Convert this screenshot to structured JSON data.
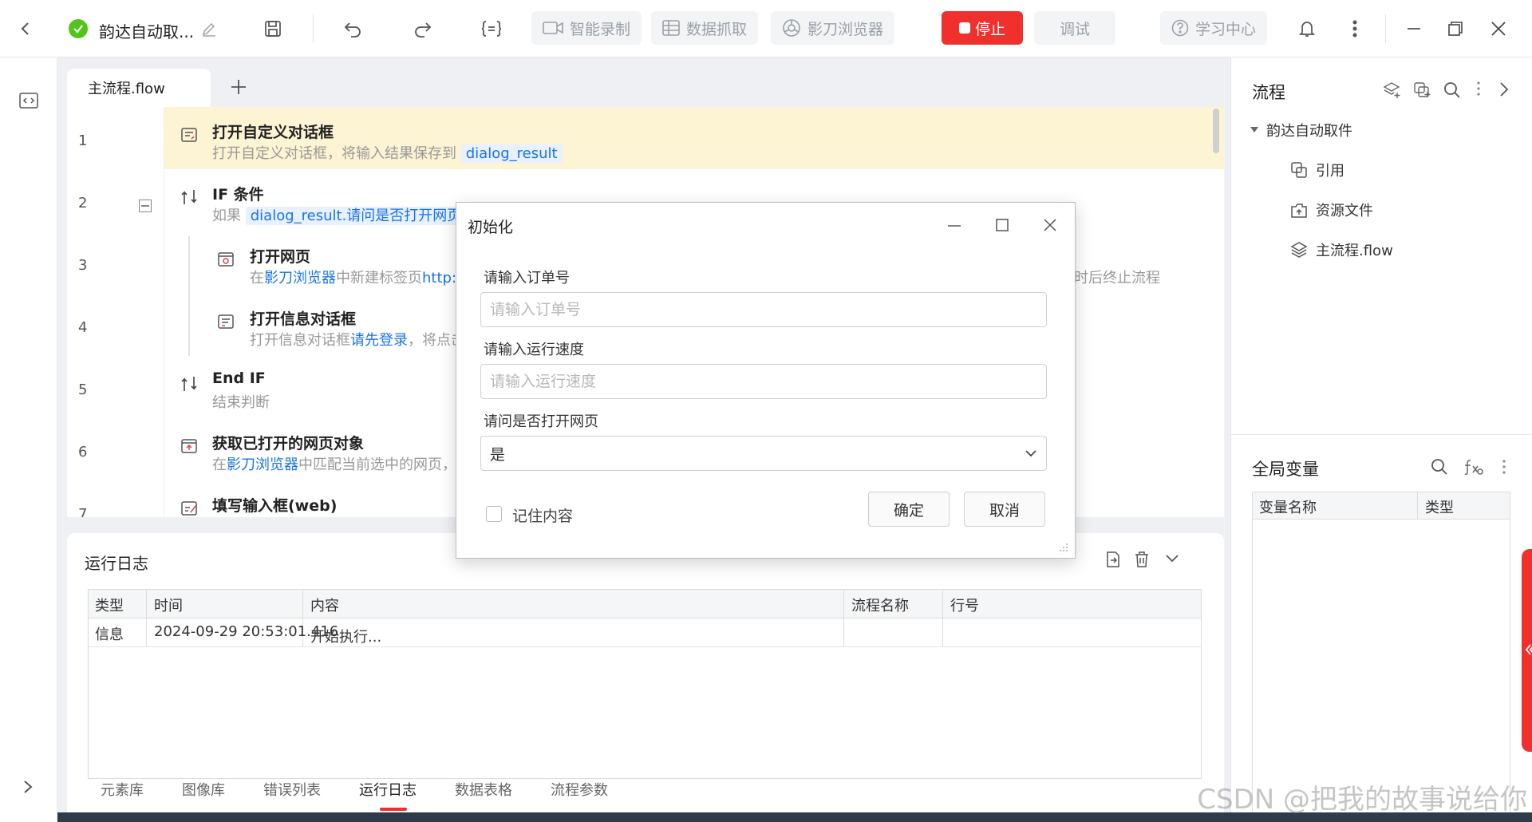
{
  "titlebar": {
    "project_name": "韵达自动取...",
    "smart_record": "智能录制",
    "data_scrape": "数据抓取",
    "browser": "影刀浏览器",
    "stop": "停止",
    "debug": "调试",
    "learning_center": "学习中心",
    "colors": {
      "stop_bg": "#f0302c",
      "ok_green": "#52c41a"
    }
  },
  "editor": {
    "tab_label": "主流程.flow",
    "steps": [
      {
        "line": "1",
        "title": "打开自定义对话框",
        "desc_prefix": "打开自定义对话框，将输入结果保存到",
        "var": "dialog_result"
      },
      {
        "line": "2",
        "title": "IF 条件",
        "desc_prefix": "如果",
        "var": "dialog_result.请问是否打开网页"
      },
      {
        "line": "3",
        "title": "打开网页",
        "desc_prefix": "在",
        "link": "影刀浏览器",
        "desc_suffix": "中新建标签页",
        "url": "http:",
        "tail": "时后终止流程"
      },
      {
        "line": "4",
        "title": "打开信息对话框",
        "desc_prefix": "打开信息对话框",
        "link": "请先登录",
        "desc_suffix": "，将点击"
      },
      {
        "line": "5",
        "title": "End IF",
        "desc_prefix": "结束判断"
      },
      {
        "line": "6",
        "title": "获取已打开的网页对象",
        "desc_prefix": "在",
        "link": "影刀浏览器",
        "desc_suffix": "中匹配当前选中的网页，"
      },
      {
        "line": "7",
        "title": "填写输入框(web)"
      }
    ]
  },
  "log": {
    "title": "运行日志",
    "columns": [
      "类型",
      "时间",
      "内容",
      "流程名称",
      "行号"
    ],
    "rows": [
      {
        "type": "信息",
        "time": "2024-09-29 20:53:01.416",
        "content": "开始执行...",
        "flow": "",
        "line": ""
      }
    ]
  },
  "bottom_tabs": [
    "元素库",
    "图像库",
    "错误列表",
    "运行日志",
    "数据表格",
    "流程参数"
  ],
  "right_panel": {
    "title": "流程",
    "tree_root": "韵达自动取件",
    "tree_items": [
      "引用",
      "资源文件",
      "主流程.flow"
    ],
    "globals_title": "全局变量",
    "globals_columns": [
      "变量名称",
      "类型"
    ]
  },
  "dialog": {
    "title": "初始化",
    "field1_label": "请输入订单号",
    "field1_placeholder": "请输入订单号",
    "field2_label": "请输入运行速度",
    "field2_placeholder": "请输入运行速度",
    "field3_label": "请问是否打开网页",
    "field3_value": "是",
    "remember_label": "记住内容",
    "ok": "确定",
    "cancel": "取消"
  },
  "watermark": "CSDN @把我的故事说给你"
}
